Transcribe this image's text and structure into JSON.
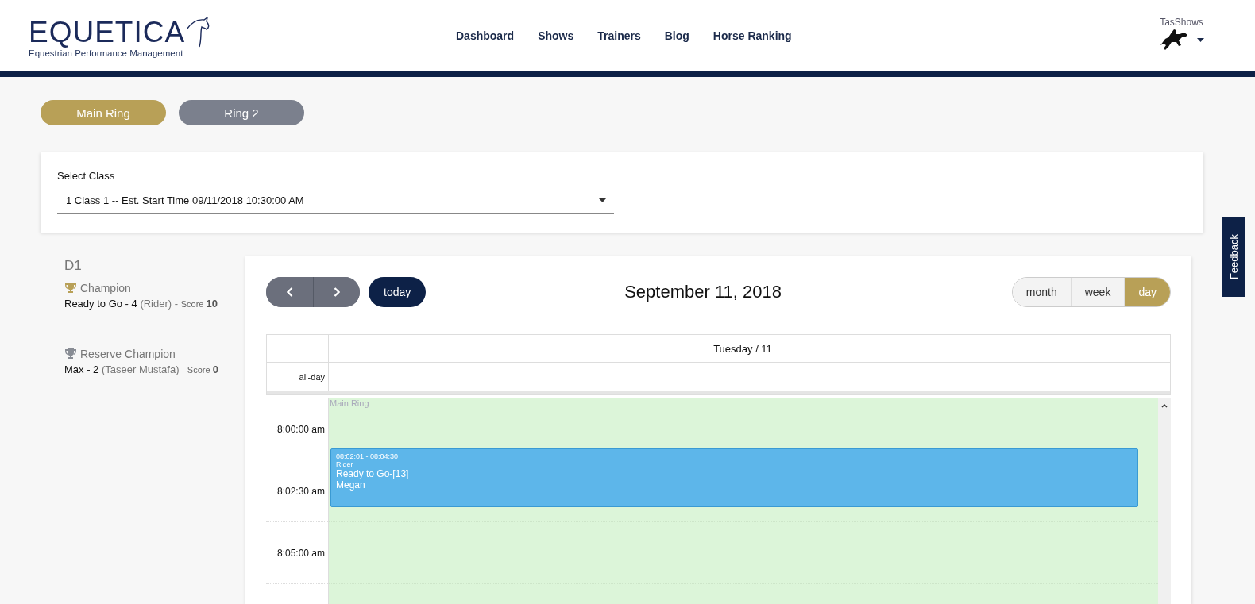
{
  "header": {
    "logo": {
      "name": "EQUETICA",
      "tagline": "Equestrian Performance Management"
    },
    "nav": [
      {
        "label": "Dashboard"
      },
      {
        "label": "Shows"
      },
      {
        "label": "Trainers"
      },
      {
        "label": "Blog"
      },
      {
        "label": "Horse Ranking"
      }
    ],
    "user": {
      "name": "TasShows"
    }
  },
  "rings": [
    {
      "label": "Main Ring",
      "selected": true
    },
    {
      "label": "Ring 2",
      "selected": false
    }
  ],
  "class_select": {
    "label": "Select Class",
    "value": "1 Class 1 -- Est. Start Time 09/11/2018 10:30:00 AM"
  },
  "results": {
    "title": "D1",
    "awards": [
      {
        "kind": "champion",
        "title": "Champion",
        "horse": "Ready to Go - 4",
        "rider": "(Rider) -",
        "score_label": "Score",
        "score": "10"
      },
      {
        "kind": "reserve",
        "title": "Reserve Champion",
        "horse": "Max - 2",
        "rider": "(Taseer Mustafa)",
        "score_label": "- Score",
        "score": "0"
      }
    ]
  },
  "calendar": {
    "today_button": "today",
    "title": "September 11, 2018",
    "views": [
      {
        "label": "month",
        "selected": false
      },
      {
        "label": "week",
        "selected": false
      },
      {
        "label": "day",
        "selected": true
      }
    ],
    "day_header": "Tuesday / 11",
    "allday_label": "all-day",
    "resource_label": "Main Ring",
    "time_slots": [
      "8:00:00 am",
      "8:02:30 am",
      "8:05:00 am"
    ],
    "events": [
      {
        "time": "08:02:01 - 08:04:30",
        "role": "Rider",
        "title": "Ready to Go-[13]",
        "rider": "Megan"
      }
    ]
  },
  "feedback": "Feedback"
}
